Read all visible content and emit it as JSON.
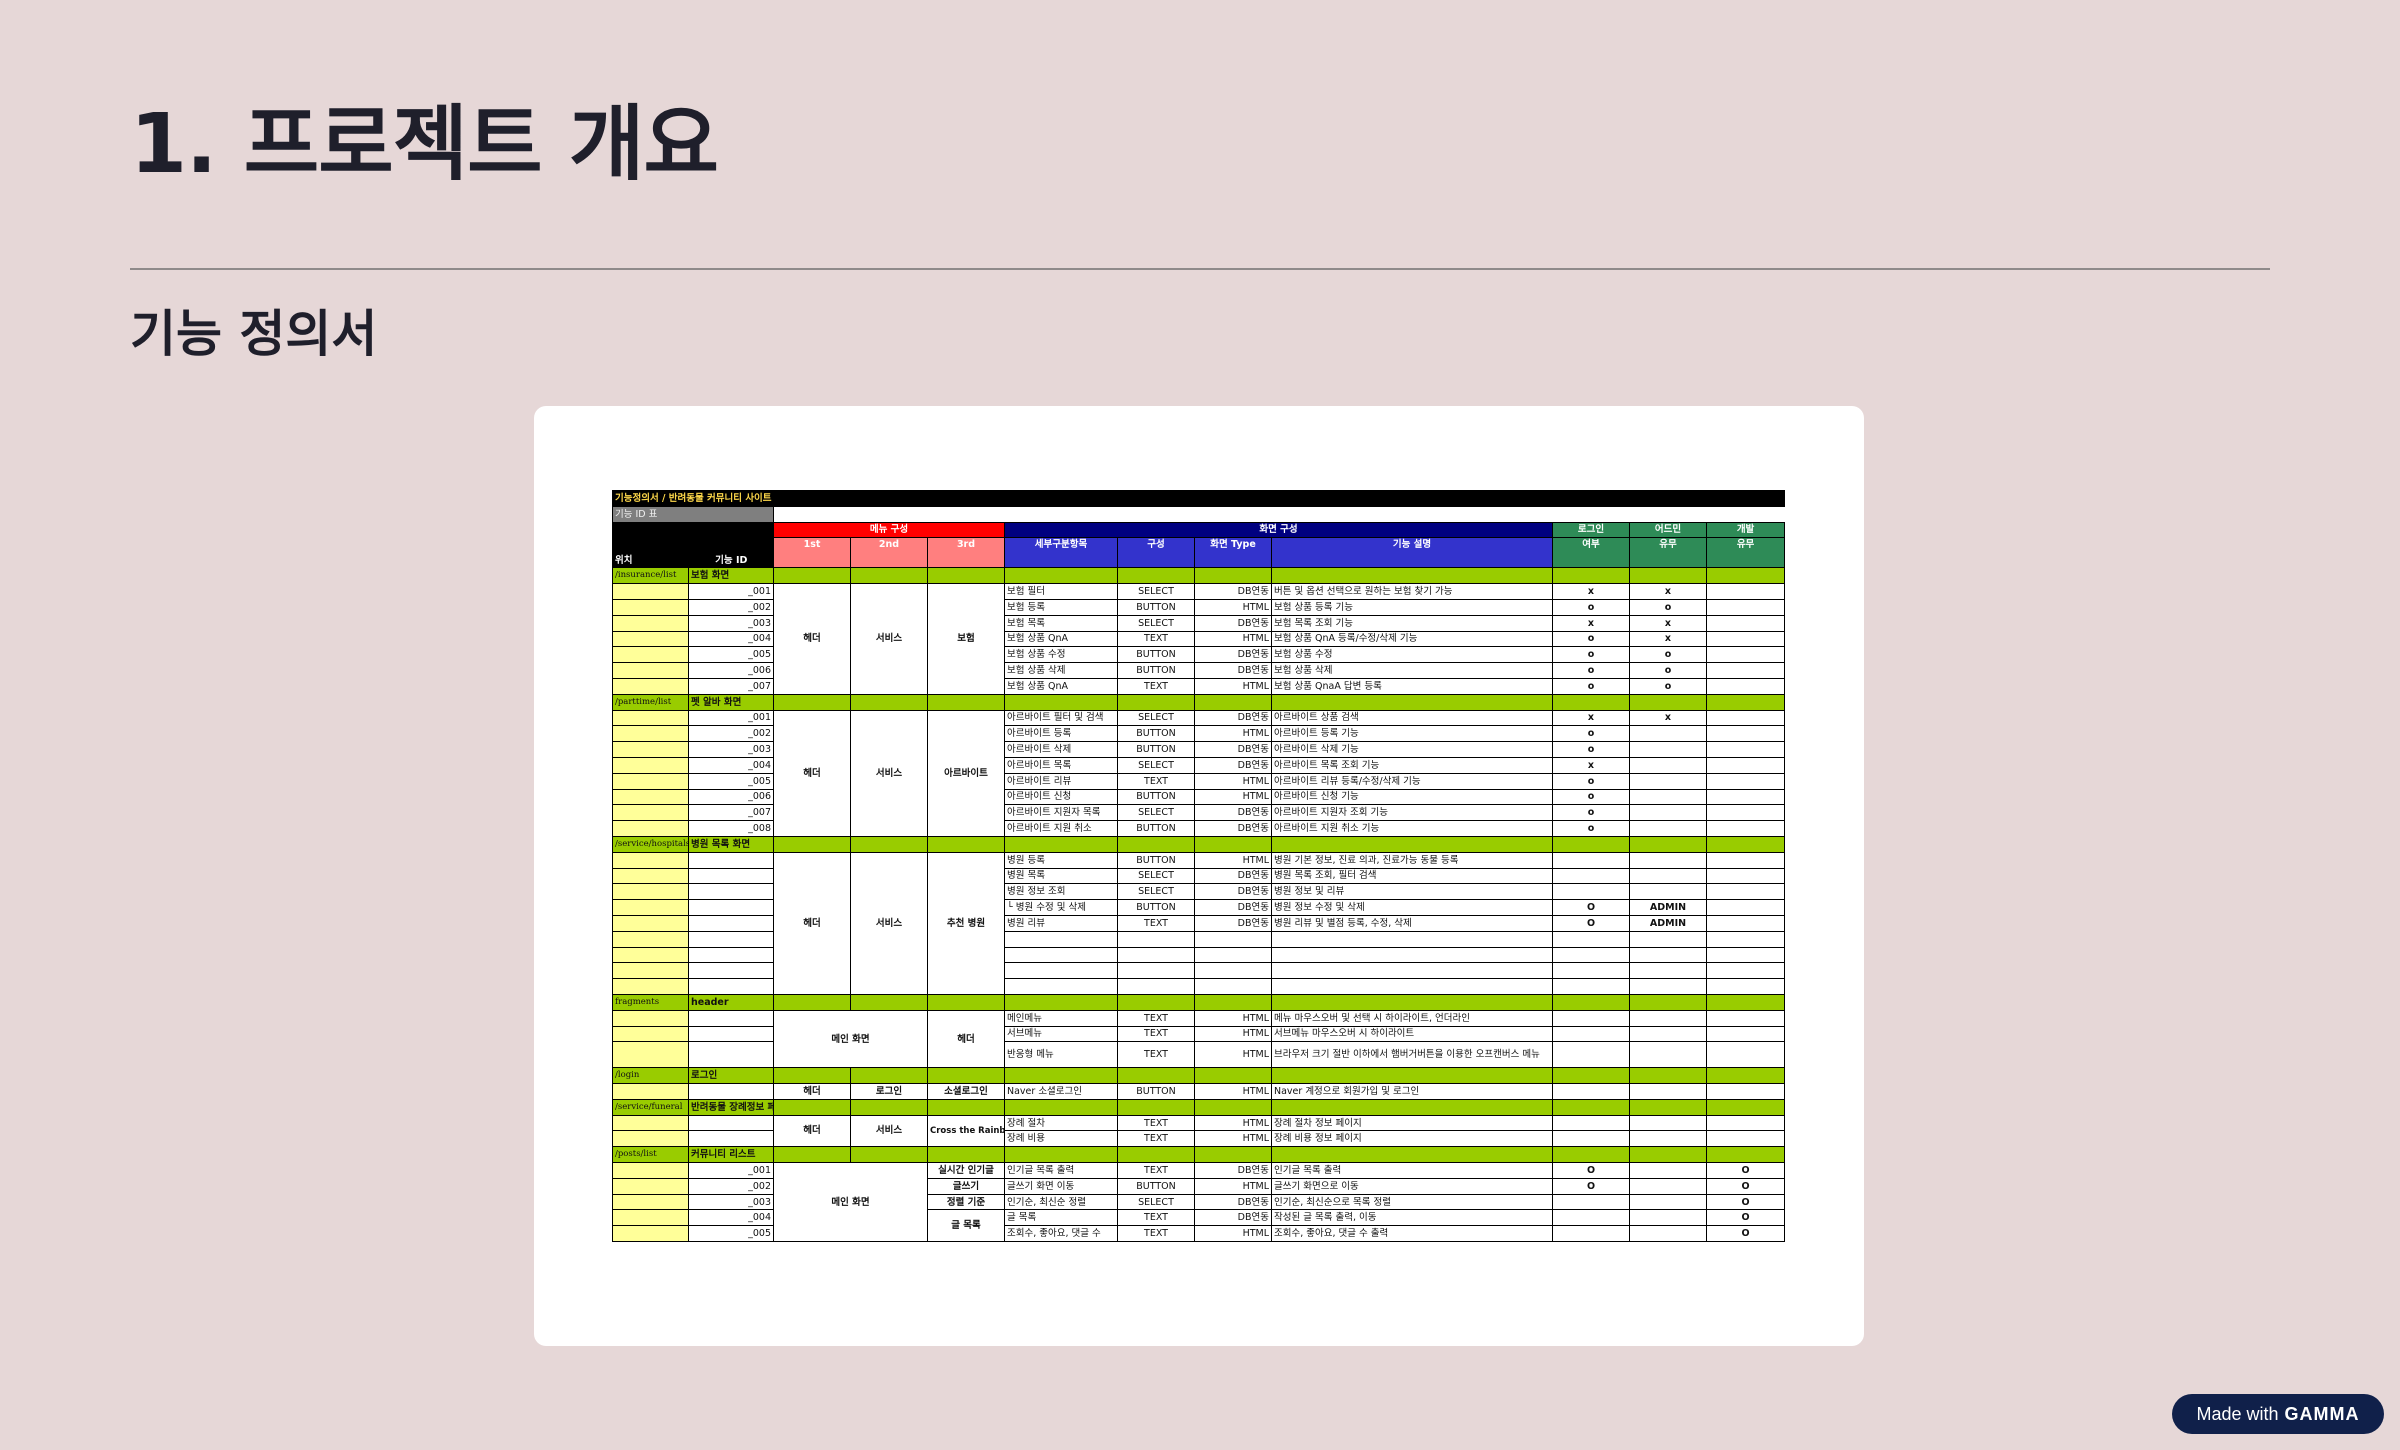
{
  "page_title": "1. 프로젝트 개요",
  "section_title": "기능 정의서",
  "badge": {
    "prefix": "Made with",
    "brand": "GAMMA"
  },
  "sheet": {
    "title": "기능정의서 / 반려동물 커뮤니티 사이트",
    "id_label": "기능 ID 표",
    "group_menu": "메뉴 구성",
    "group_screen": "화면 구성",
    "h_login": "로그인",
    "h_role": "어드민",
    "h_dev": "개발",
    "h_pos": "위치",
    "h_fid": "기능 ID",
    "h_1st": "1st",
    "h_2nd": "2nd",
    "h_3rd": "3rd",
    "h_item": "세부구분항목",
    "h_comp": "구성",
    "h_type": "화면 Type",
    "h_desc": "기능 설명",
    "h_login2": "여부",
    "h_role2": "유무",
    "h_dev2": "유무",
    "insurance": {
      "loc": "/insurance/list",
      "name": "보험 화면",
      "m1": "헤더",
      "m2": "서비스",
      "m3": "보험",
      "rows": [
        {
          "id": "_001",
          "item": "보험 필터",
          "comp": "SELECT",
          "type": "DB연동",
          "desc": "버튼 및 옵션 선택으로 원하는 보험 찾기 가능",
          "l": "x",
          "a": "x",
          "d": ""
        },
        {
          "id": "_002",
          "item": "보험 등록",
          "comp": "BUTTON",
          "type": "HTML",
          "desc": "보험 상품 등록 기능",
          "l": "o",
          "a": "o",
          "d": ""
        },
        {
          "id": "_003",
          "item": "보험 목록",
          "comp": "SELECT",
          "type": "DB연동",
          "desc": "보험 목록 조회 기능",
          "l": "x",
          "a": "x",
          "d": ""
        },
        {
          "id": "_004",
          "item": "보험 상품 QnA",
          "comp": "TEXT",
          "type": "HTML",
          "desc": "보험 상품 QnA 등록/수정/삭제 기능",
          "l": "o",
          "a": "x",
          "d": ""
        },
        {
          "id": "_005",
          "item": "보험 상품 수정",
          "comp": "BUTTON",
          "type": "DB연동",
          "desc": "보험 상품 수정",
          "l": "o",
          "a": "o",
          "d": ""
        },
        {
          "id": "_006",
          "item": "보험 상품 삭제",
          "comp": "BUTTON",
          "type": "DB연동",
          "desc": "보험 상품 삭제",
          "l": "o",
          "a": "o",
          "d": ""
        },
        {
          "id": "_007",
          "item": "보험 상품 QnA",
          "comp": "TEXT",
          "type": "HTML",
          "desc": "보험 상품 QnaA 답변 등록",
          "l": "o",
          "a": "o",
          "d": ""
        }
      ]
    },
    "parttime": {
      "loc": "/parttime/list",
      "name": "펫 알바 화면",
      "m1": "헤더",
      "m2": "서비스",
      "m3": "아르바이트",
      "rows": [
        {
          "id": "_001",
          "item": "아르바이트 필터 및 검색",
          "comp": "SELECT",
          "type": "DB연동",
          "desc": "아르바이트 상품 검색",
          "l": "x",
          "a": "x",
          "d": ""
        },
        {
          "id": "_002",
          "item": "아르바이트 등록",
          "comp": "BUTTON",
          "type": "HTML",
          "desc": "아르바이트 등록 기능",
          "l": "o",
          "a": "",
          "d": ""
        },
        {
          "id": "_003",
          "item": "아르바이트 삭제",
          "comp": "BUTTON",
          "type": "DB연동",
          "desc": "아르바이트 삭제 기능",
          "l": "o",
          "a": "",
          "d": ""
        },
        {
          "id": "_004",
          "item": "아르바이트 목록",
          "comp": "SELECT",
          "type": "DB연동",
          "desc": "아르바이트 목록 조회 기능",
          "l": "x",
          "a": "",
          "d": ""
        },
        {
          "id": "_005",
          "item": "아르바이트 리뷰",
          "comp": "TEXT",
          "type": "HTML",
          "desc": "아르바이트 리뷰 등록/수정/삭제 기능",
          "l": "o",
          "a": "",
          "d": ""
        },
        {
          "id": "_006",
          "item": "아르바이트 신청",
          "comp": "BUTTON",
          "type": "HTML",
          "desc": "아르바이트 신청 기능",
          "l": "o",
          "a": "",
          "d": ""
        },
        {
          "id": "_007",
          "item": "아르바이트 지원자 목록",
          "comp": "SELECT",
          "type": "DB연동",
          "desc": "아르바이트 지원자 조회 기능",
          "l": "o",
          "a": "",
          "d": ""
        },
        {
          "id": "_008",
          "item": "아르바이트 지원 취소",
          "comp": "BUTTON",
          "type": "DB연동",
          "desc": "아르바이트 지원 취소 기능",
          "l": "o",
          "a": "",
          "d": ""
        }
      ]
    },
    "hospital": {
      "loc": "/service/hospitals",
      "name": "병원 목록 화면",
      "m1": "헤더",
      "m2": "서비스",
      "m3": "추천 병원",
      "rows": [
        {
          "item": "병원 등록",
          "comp": "BUTTON",
          "type": "HTML",
          "desc": "병원 기본 정보, 진료 의과, 진료가능 동물 등록",
          "l": "",
          "a": "",
          "d": ""
        },
        {
          "item": "병원 목록",
          "comp": "SELECT",
          "type": "DB연동",
          "desc": "병원 목록 조회, 필터 검색",
          "l": "",
          "a": "",
          "d": ""
        },
        {
          "item": "병원 정보 조회",
          "comp": "SELECT",
          "type": "DB연동",
          "desc": "병원 정보 및 리뷰",
          "l": "",
          "a": "",
          "d": ""
        },
        {
          "item": "└ 병원 수정 및 삭제",
          "comp": "BUTTON",
          "type": "DB연동",
          "desc": "병원 정보 수정 및 삭제",
          "l": "O",
          "a": "ADMIN",
          "d": ""
        },
        {
          "item": "병원 리뷰",
          "comp": "TEXT",
          "type": "DB연동",
          "desc": "병원 리뷰 및 별점 등록, 수정, 삭제",
          "l": "O",
          "a": "ADMIN",
          "d": ""
        }
      ]
    },
    "header": {
      "loc": "fragments",
      "name": "header",
      "m12": "메인 화면",
      "m3": "헤더",
      "rows": [
        {
          "item": "메인메뉴",
          "comp": "TEXT",
          "type": "HTML",
          "desc": "메뉴 마우스오버 및 선택 시 하이라이트, 언더라인"
        },
        {
          "item": "서브메뉴",
          "comp": "TEXT",
          "type": "HTML",
          "desc": "서브메뉴 마우스오버 시 하이라이트"
        },
        {
          "item": "반응형 메뉴",
          "comp": "TEXT",
          "type": "HTML",
          "desc": "브라우저 크기 절반 이하에서 햄버거버튼을 이용한 오프캔버스 메뉴"
        }
      ]
    },
    "login": {
      "loc": "/login",
      "name": "로그인",
      "m1": "헤더",
      "m2": "로그인",
      "m3": "소셜로그인",
      "item": "Naver 소셜로그인",
      "comp": "BUTTON",
      "type": "HTML",
      "desc": "Naver 계정으로 회원가입 및 로그인"
    },
    "funeral": {
      "loc": "/service/funeral",
      "name": "반려동물 장례정보 페이지",
      "m1": "헤더",
      "m2": "서비스",
      "m3": "Cross the Rainbow Bridge",
      "rows": [
        {
          "item": "장례 절차",
          "comp": "TEXT",
          "type": "HTML",
          "desc": "장례 절차 정보 페이지"
        },
        {
          "item": "장례 비용",
          "comp": "TEXT",
          "type": "HTML",
          "desc": "장례 비용 정보 페이지"
        }
      ]
    },
    "posts": {
      "loc": "/posts/list",
      "name": "커뮤니티 리스트",
      "m12": "메인 화면",
      "m3_list": "글 목록",
      "rows": [
        {
          "id": "_001",
          "m3": "실시간 인기글",
          "item": "인기글 목록 출력",
          "comp": "TEXT",
          "type": "DB연동",
          "desc": "인기글 목록 출력",
          "l": "O",
          "a": "",
          "d": "O"
        },
        {
          "id": "_002",
          "m3": "글쓰기",
          "item": "글쓰기 화면 이동",
          "comp": "BUTTON",
          "type": "HTML",
          "desc": "글쓰기 화면으로 이동",
          "l": "O",
          "a": "",
          "d": "O"
        },
        {
          "id": "_003",
          "m3": "정렬 기준",
          "item": "인기순, 최신순 정렬",
          "comp": "SELECT",
          "type": "DB연동",
          "desc": "인기순, 최신순으로 목록 정렬",
          "l": "",
          "a": "",
          "d": "O"
        },
        {
          "id": "_004",
          "item": "글 목록",
          "comp": "TEXT",
          "type": "DB연동",
          "desc": "작성된 글 목록 출력, 이동",
          "l": "",
          "a": "",
          "d": "O"
        },
        {
          "id": "_005",
          "item": "조회수, 좋아요, 댓글 수",
          "comp": "TEXT",
          "type": "HTML",
          "desc": "조회수, 좋아요, 댓글 수 출력",
          "l": "",
          "a": "",
          "d": "O"
        }
      ]
    }
  }
}
